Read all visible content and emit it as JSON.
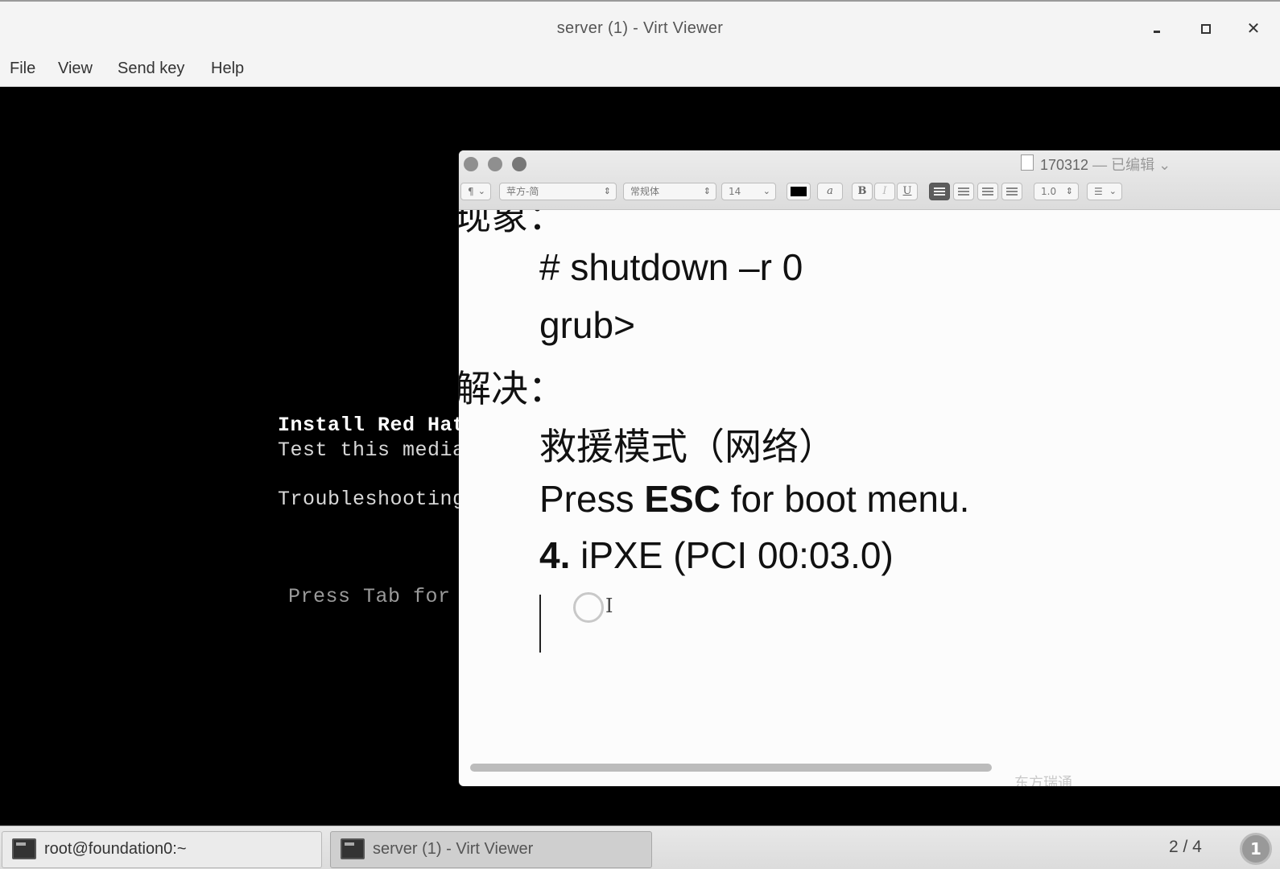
{
  "window": {
    "title": "server (1) - Virt Viewer",
    "close_glyph": "✕"
  },
  "menu": [
    "File",
    "View",
    "Send key",
    "Help"
  ],
  "console": {
    "lines": [
      "Install Red Hat",
      "Test this media",
      "Troubleshooting",
      "Press Tab for"
    ]
  },
  "editor": {
    "doc_title": "170312",
    "doc_status": "— 已编辑",
    "toolbar": {
      "paragraph": "¶",
      "font": "苹方-简",
      "style": "常规体",
      "size": "14",
      "bold": "B",
      "italic": "I",
      "underline": "U",
      "spacing": "1.0",
      "list": "☰"
    },
    "lines": {
      "heading1": "现象：",
      "cmd": "# shutdown –r 0",
      "grub": "grub>",
      "heading2": "解决：",
      "rescue": "救援模式（网络）",
      "press_pre": "Press ",
      "press_key": "ESC",
      "press_post": " for boot menu.",
      "ipxe_num": "4.",
      "ipxe_text": " iPXE (PCI 00:03.0)"
    },
    "ibeam": "I",
    "watermark": "东方瑞通"
  },
  "taskbar": {
    "items": [
      "root@foundation0:~",
      "server (1) - Virt Viewer"
    ],
    "workspace": "2 / 4",
    "notification_count": "1"
  },
  "icons": {
    "minimize": "minimize-icon",
    "maximize": "maximize-icon",
    "close": "close-icon",
    "terminal": "terminal-icon",
    "document": "document-icon"
  }
}
